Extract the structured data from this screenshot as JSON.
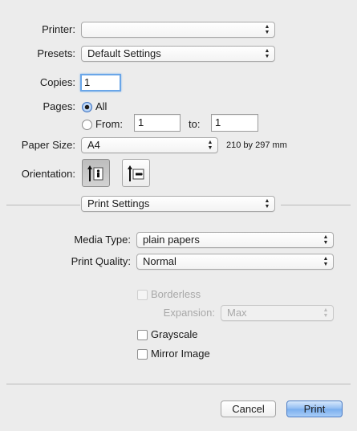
{
  "printer": {
    "label": "Printer:",
    "value": ""
  },
  "presets": {
    "label": "Presets:",
    "value": "Default Settings"
  },
  "copies": {
    "label": "Copies:",
    "value": "1"
  },
  "pages": {
    "label": "Pages:",
    "all_label": "All",
    "from_label": "From:",
    "from_value": "1",
    "to_label": "to:",
    "to_value": "1",
    "selected": "All"
  },
  "paper_size": {
    "label": "Paper Size:",
    "value": "A4",
    "dimensions": "210 by 297 mm"
  },
  "orientation": {
    "label": "Orientation:",
    "options": [
      "portrait",
      "landscape"
    ],
    "selected": "portrait"
  },
  "section_menu": {
    "value": "Print Settings"
  },
  "print_settings": {
    "media_type": {
      "label": "Media Type:",
      "value": "plain papers"
    },
    "print_quality": {
      "label": "Print Quality:",
      "value": "Normal"
    },
    "borderless": {
      "label": "Borderless",
      "checked": false,
      "enabled": false
    },
    "expansion": {
      "label": "Expansion:",
      "value": "Max",
      "enabled": false
    },
    "grayscale": {
      "label": "Grayscale",
      "checked": false
    },
    "mirror_image": {
      "label": "Mirror Image",
      "checked": false
    }
  },
  "buttons": {
    "cancel": "Cancel",
    "print": "Print"
  },
  "colors": {
    "accent": "#79aeee",
    "focus": "#6aa6e8",
    "background": "#ececec"
  }
}
